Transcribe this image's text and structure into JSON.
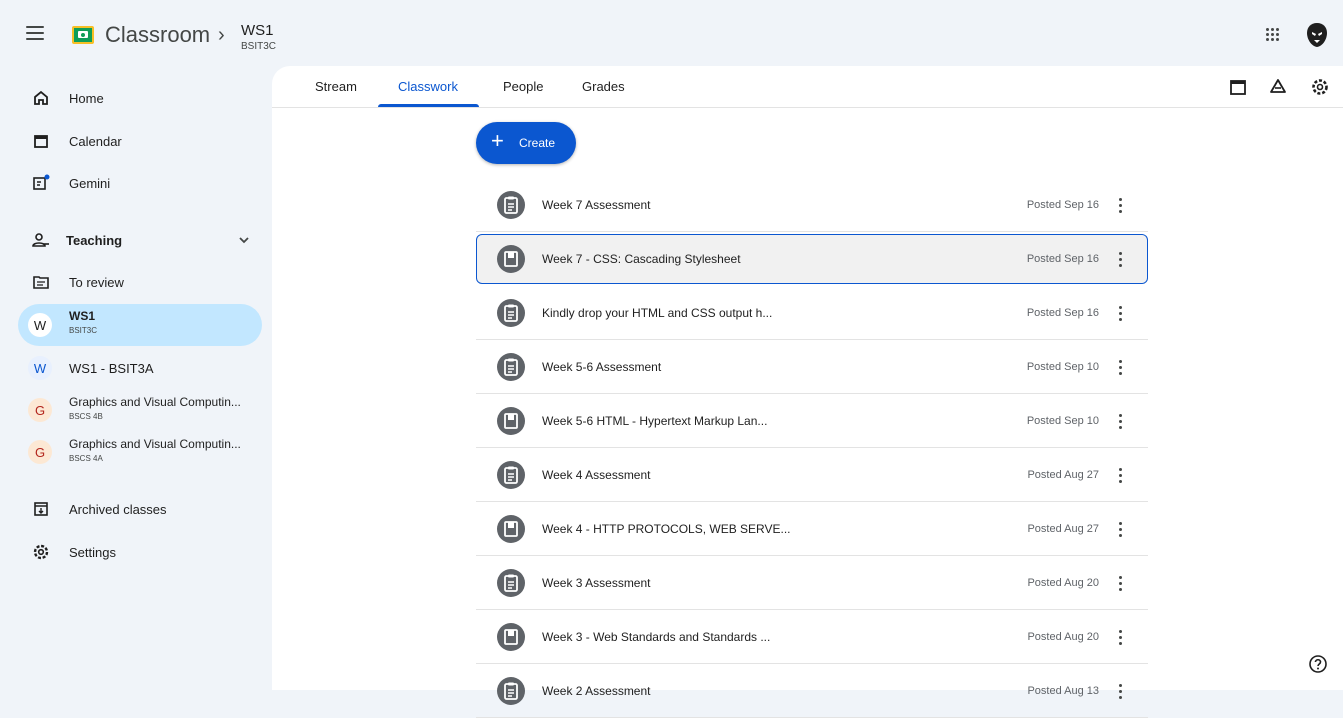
{
  "header": {
    "app_title": "Classroom",
    "class_name": "WS1",
    "class_section": "BSIT3C"
  },
  "sidebar": {
    "home": "Home",
    "calendar": "Calendar",
    "gemini": "Gemini",
    "teaching": "Teaching",
    "to_review": "To review",
    "classes": [
      {
        "letter": "W",
        "name": "WS1",
        "section": "BSIT3C"
      },
      {
        "letter": "W",
        "name": "WS1 - BSIT3A",
        "section": ""
      },
      {
        "letter": "G",
        "name": "Graphics and Visual Computin...",
        "section": "BSCS 4B"
      },
      {
        "letter": "G",
        "name": "Graphics and Visual Computin...",
        "section": "BSCS 4A"
      }
    ],
    "archived": "Archived classes",
    "settings": "Settings"
  },
  "tabs": [
    "Stream",
    "Classwork",
    "People",
    "Grades"
  ],
  "active_tab": "Classwork",
  "create_label": "Create",
  "items": [
    {
      "kind": "assignment",
      "title": "Week 7 Assessment",
      "date": "Posted Sep 16"
    },
    {
      "kind": "material",
      "title": "Week 7 - CSS: Cascading Stylesheet",
      "date": "Posted Sep 16"
    },
    {
      "kind": "assignment",
      "title": "Kindly drop your HTML and CSS output h...",
      "date": "Posted Sep 16"
    },
    {
      "kind": "assignment",
      "title": "Week 5-6 Assessment",
      "date": "Posted Sep 10"
    },
    {
      "kind": "material",
      "title": "Week 5-6 HTML - Hypertext Markup Lan...",
      "date": "Posted Sep 10"
    },
    {
      "kind": "assignment",
      "title": "Week 4 Assessment",
      "date": "Posted Aug 27"
    },
    {
      "kind": "material",
      "title": "Week 4 - HTTP PROTOCOLS, WEB SERVE...",
      "date": "Posted Aug 27"
    },
    {
      "kind": "assignment",
      "title": "Week 3 Assessment",
      "date": "Posted Aug 20"
    },
    {
      "kind": "material",
      "title": "Week 3 - Web Standards and Standards ...",
      "date": "Posted Aug 20"
    },
    {
      "kind": "assignment",
      "title": "Week 2 Assessment",
      "date": "Posted Aug 13"
    }
  ],
  "colors": {
    "accent": "#0b57d0",
    "selected_nav": "#c2e7ff",
    "background": "#f0f4f9"
  }
}
